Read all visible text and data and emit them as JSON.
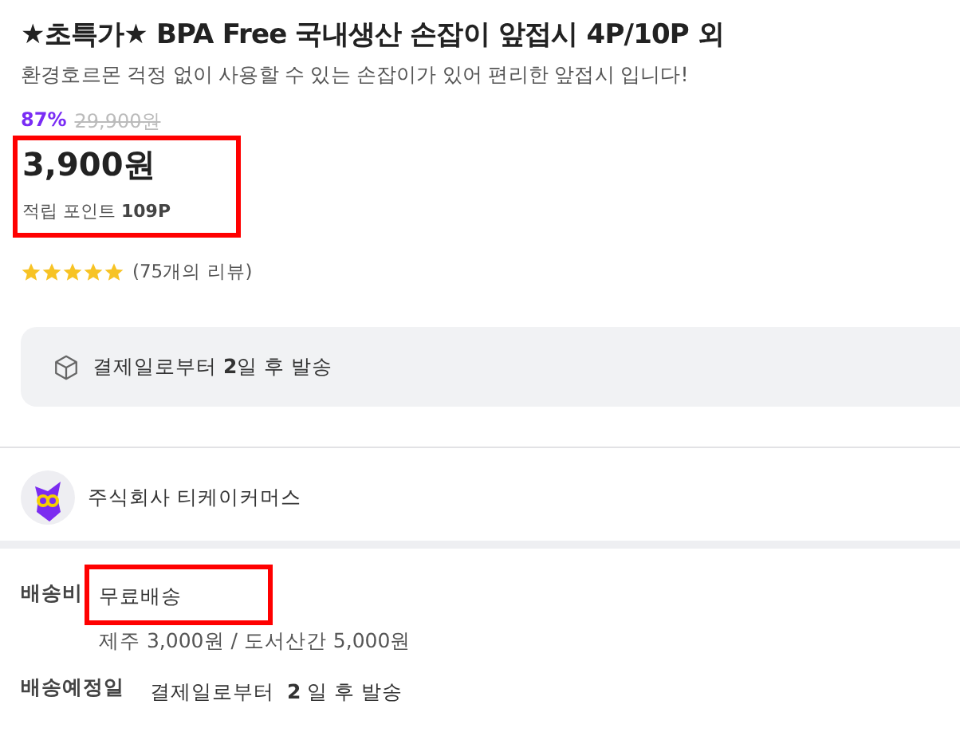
{
  "product": {
    "title": "★초특가★ BPA Free 국내생산 손잡이 앞접시 4P/10P 외",
    "subtitle": "환경호르몬 걱정 없이 사용할 수 있는 손잡이가 있어 편리한 앞접시 입니다!"
  },
  "price": {
    "discount": "87%",
    "original": "29,900원",
    "current": "3,900원",
    "points_label": "적립 포인트",
    "points": "109P",
    "highlighted": true
  },
  "rating": {
    "stars": 5,
    "reviews": "(75개의 리뷰)"
  },
  "dispatch_notice": "결제일로부터 **2**일 후 발송",
  "seller": {
    "name": "주식회사 티케이커머스"
  },
  "shipping": [
    {
      "label": "배송비",
      "value": "무료배송",
      "highlighted": true,
      "note": "제주 3,000원 / 도서산간 5,000원"
    },
    {
      "label": "배송예정일",
      "value": "결제일로부터  **2** 일 후 발송"
    }
  ]
}
